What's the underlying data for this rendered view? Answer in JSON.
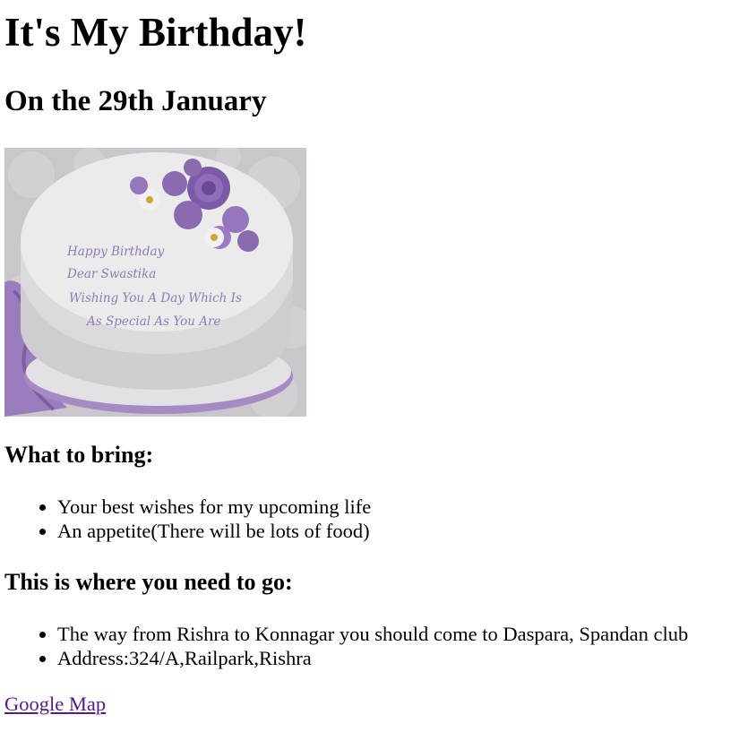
{
  "title": "It's My Birthday!",
  "date_heading": "On the 29th January",
  "cake_image": {
    "lines": [
      "Happy Birthday",
      "Dear Swastika",
      "Wishing You A Day Which Is",
      "As Special As You Are"
    ],
    "colors": {
      "cake": "#ecebec",
      "flower": "#8a6bb0",
      "text": "#8f7ab8",
      "background": "#c9c6cc"
    }
  },
  "bring": {
    "heading": "What to bring:",
    "items": [
      "Your best wishes for my upcoming life",
      "An appetite(There will be lots of food)"
    ]
  },
  "go": {
    "heading": "This is where you need to go:",
    "items": [
      "The way from Rishra to Konnagar you should come to Daspara, Spandan club",
      "Address:324/A,Railpark,Rishra"
    ]
  },
  "map_link": {
    "label": "Google Map",
    "color": "#551a8b"
  }
}
